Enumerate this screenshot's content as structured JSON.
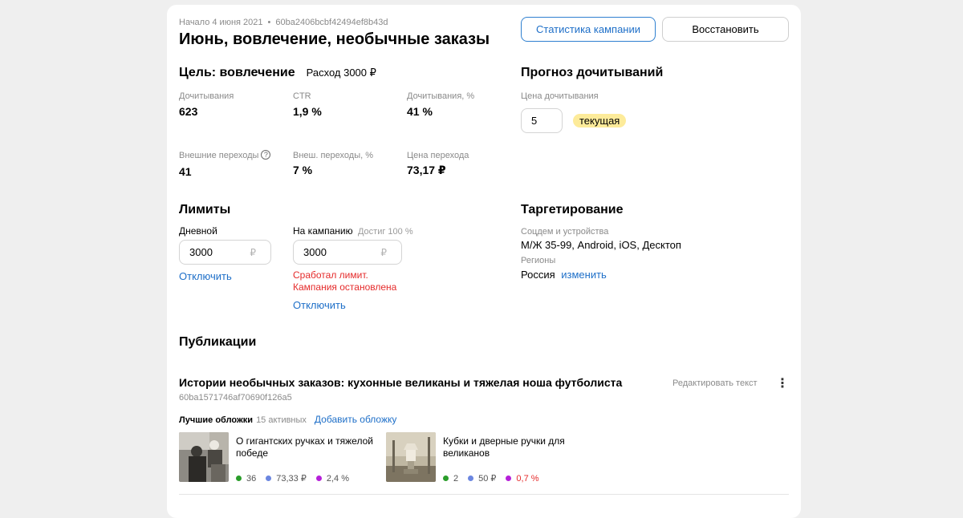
{
  "campaign": {
    "start": "Начало 4 июня 2021",
    "id": "60ba2406bcbf42494ef8b43d",
    "title": "Июнь, вовлечение, необычные заказы",
    "stats_button": "Статистика кампании",
    "restore_button": "Восстановить"
  },
  "goal": {
    "heading": "Цель: вовлечение",
    "spend": "Расход 3000 ₽",
    "metrics": [
      {
        "label": "Дочитывания",
        "value": "623"
      },
      {
        "label": "CTR",
        "value": "1,9 %"
      },
      {
        "label": "Дочитывания, %",
        "value": "41 %"
      },
      {
        "label": "Внешние переходы",
        "value": "41"
      },
      {
        "label": "Внеш. переходы, %",
        "value": "7 %"
      },
      {
        "label": "Цена перехода",
        "value": "73,17 ₽"
      }
    ],
    "help_glyph": "?"
  },
  "forecast": {
    "heading": "Прогноз дочитываний",
    "price_label": "Цена дочитывания",
    "price_value": "5",
    "badge": "текущая"
  },
  "limits": {
    "heading": "Лимиты",
    "daily_label": "Дневной",
    "daily_value": "3000",
    "campaign_label": "На кампанию",
    "campaign_reached": "Достиг 100 %",
    "campaign_value": "3000",
    "currency": "₽",
    "disable_link": "Отключить",
    "error_line1": "Сработал лимит.",
    "error_line2": "Кампания остановлена"
  },
  "targeting": {
    "heading": "Таргетирование",
    "socdem_label": "Соцдем и устройства",
    "socdem_value": "М/Ж 35-99, Android, iOS, Десктоп",
    "regions_label": "Регионы",
    "regions_value": "Россия",
    "change_link": "изменить"
  },
  "publications": {
    "heading": "Публикации",
    "item": {
      "title": "Истории необычных заказов: кухонные великаны и тяжелая ноша футболиста",
      "id": "60ba1571746af70690f126a5",
      "edit_link": "Редактировать текст",
      "more_glyph": "⋮",
      "best_covers": "Лучшие обложки",
      "active_count": "15 активных",
      "add_cover": "Добавить обложку",
      "covers": [
        {
          "title": "О гигантских ручках и тяжелой победе",
          "reads": "36",
          "price": "73,33 ₽",
          "ctr": "2,4 %"
        },
        {
          "title": "Кубки и дверные ручки для великанов",
          "reads": "2",
          "price": "50 ₽",
          "ctr": "0,7 %"
        }
      ]
    }
  },
  "colors": {
    "accent": "#1e6fc8",
    "error": "#e52b2b",
    "badge": "#fdeb9a",
    "dot_green": "#2a9d2a",
    "dot_blue": "#6b86e0",
    "dot_purple": "#b620d9"
  }
}
